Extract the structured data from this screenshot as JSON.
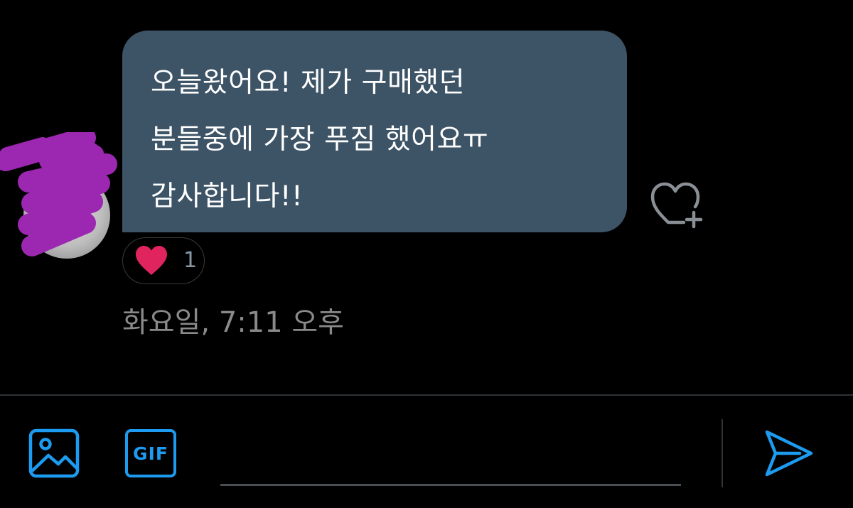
{
  "message": {
    "lines": [
      "오늘왔어요! 제가 구매했던",
      "분들중에 가장 푸짐 했어요ㅠ",
      "감사합니다!!"
    ],
    "reaction_count": "1",
    "timestamp": "화요일, 7:11 오후"
  },
  "icons": {
    "add_reaction": "heart-plus-icon",
    "reaction": "red-heart-icon",
    "media": "image-icon",
    "gif": "GIF",
    "send": "send-icon"
  },
  "colors": {
    "background": "#000000",
    "bubble": "#3d5366",
    "accent": "#1d9bf0",
    "heart": "#e0245e",
    "redaction": "#9c27b0"
  }
}
